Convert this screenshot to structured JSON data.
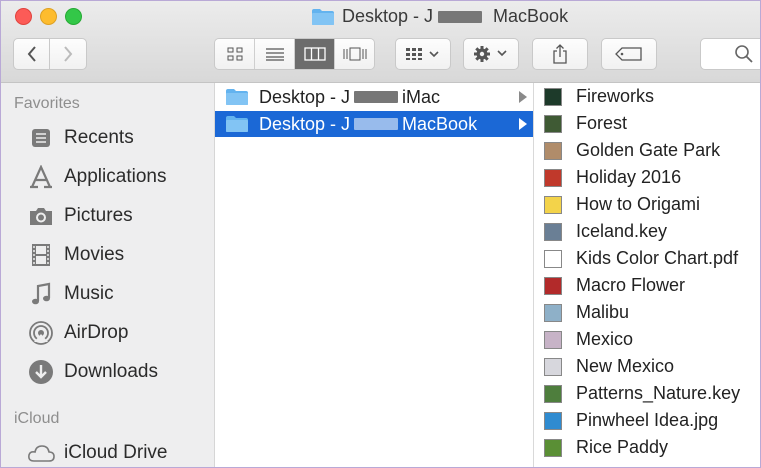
{
  "window": {
    "title_left": "Desktop - J",
    "title_right": "MacBook"
  },
  "toolbar": {
    "back_icon": "chevron-left-icon",
    "forward_icon": "chevron-right-icon",
    "view_modes": [
      "icon-view-icon",
      "list-view-icon",
      "column-view-icon",
      "cover-flow-icon"
    ],
    "active_view": "column-view-icon",
    "arrange_icon": "group-grid-icon",
    "action_icon": "gear-icon",
    "share_icon": "share-icon",
    "tags_icon": "tag-icon",
    "search_icon": "search-icon"
  },
  "sidebar": {
    "favorites_header": "Favorites",
    "favorites": [
      {
        "label": "Recents",
        "icon": "recents-icon"
      },
      {
        "label": "Applications",
        "icon": "applications-icon"
      },
      {
        "label": "Pictures",
        "icon": "camera-icon"
      },
      {
        "label": "Movies",
        "icon": "film-icon"
      },
      {
        "label": "Music",
        "icon": "music-note-icon"
      },
      {
        "label": "AirDrop",
        "icon": "airdrop-icon"
      },
      {
        "label": "Downloads",
        "icon": "download-icon"
      }
    ],
    "icloud_header": "iCloud",
    "icloud": [
      {
        "label": "iCloud Drive",
        "icon": "cloud-icon"
      }
    ]
  },
  "column1": {
    "items": [
      {
        "left": "Desktop - J",
        "right": "iMac",
        "selected": false
      },
      {
        "left": "Desktop - J",
        "right": "MacBook",
        "selected": true
      }
    ]
  },
  "column2": {
    "items": [
      {
        "label": "Fireworks",
        "color": "#1d3a2a"
      },
      {
        "label": "Forest",
        "color": "#3f5a34"
      },
      {
        "label": "Golden Gate Park",
        "color": "#b08c6a"
      },
      {
        "label": "Holiday 2016",
        "color": "#c0392b"
      },
      {
        "label": "How to Origami",
        "color": "#f3d34a"
      },
      {
        "label": "Iceland.key",
        "color": "#6a7f95"
      },
      {
        "label": "Kids Color Chart.pdf",
        "color": "#ffffff"
      },
      {
        "label": "Macro Flower",
        "color": "#b22a2a"
      },
      {
        "label": "Malibu",
        "color": "#8eb0c8"
      },
      {
        "label": "Mexico",
        "color": "#c7b3c7"
      },
      {
        "label": "New Mexico",
        "color": "#d7d7dd"
      },
      {
        "label": "Patterns_Nature.key",
        "color": "#4e7e3d"
      },
      {
        "label": "Pinwheel Idea.jpg",
        "color": "#2f8bd0"
      },
      {
        "label": "Rice Paddy",
        "color": "#5a8f35"
      }
    ]
  },
  "colors": {
    "selection": "#1b68d6",
    "folder": "#63b3ef",
    "sidebar_bg": "#eeeeef"
  }
}
